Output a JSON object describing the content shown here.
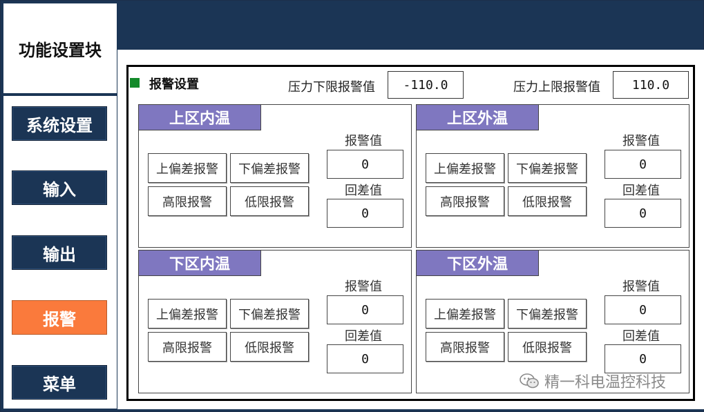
{
  "brand": {
    "title": "功能设置块"
  },
  "nav": {
    "items": [
      {
        "label": "系统设置",
        "active": false
      },
      {
        "label": "输入",
        "active": false
      },
      {
        "label": "输出",
        "active": false
      },
      {
        "label": "报警",
        "active": true
      },
      {
        "label": "菜单",
        "active": false
      }
    ]
  },
  "alarm": {
    "section_title": "报警设置",
    "pressure_low_label": "压力下限报警值",
    "pressure_low_value": "-110.0",
    "pressure_high_label": "压力上限报警值",
    "pressure_high_value": "110.0"
  },
  "zones": [
    {
      "title": "上区内温",
      "btn_upper_dev": "上偏差报警",
      "btn_lower_dev": "下偏差报警",
      "btn_high": "高限报警",
      "btn_low": "低限报警",
      "alarm_label": "报警值",
      "alarm_value": "0",
      "hyst_label": "回差值",
      "hyst_value": "0"
    },
    {
      "title": "上区外温",
      "btn_upper_dev": "上偏差报警",
      "btn_lower_dev": "下偏差报警",
      "btn_high": "高限报警",
      "btn_low": "低限报警",
      "alarm_label": "报警值",
      "alarm_value": "0",
      "hyst_label": "回差值",
      "hyst_value": "0"
    },
    {
      "title": "下区内温",
      "btn_upper_dev": "上偏差报警",
      "btn_lower_dev": "下偏差报警",
      "btn_high": "高限报警",
      "btn_low": "低限报警",
      "alarm_label": "报警值",
      "alarm_value": "0",
      "hyst_label": "回差值",
      "hyst_value": "0"
    },
    {
      "title": "下区外温",
      "btn_upper_dev": "上偏差报警",
      "btn_lower_dev": "下偏差报警",
      "btn_high": "高限报警",
      "btn_low": "低限报警",
      "alarm_label": "报警值",
      "alarm_value": "0",
      "hyst_label": "回差值",
      "hyst_value": "0"
    }
  ],
  "watermark": {
    "text": "精一科电温控科技",
    "icon": "wechat-icon"
  },
  "colors": {
    "navy": "#1b3555",
    "active_orange": "#fa7a3c",
    "zone_header_purple": "#7f77c0",
    "section_marker_green": "#138a2a"
  }
}
